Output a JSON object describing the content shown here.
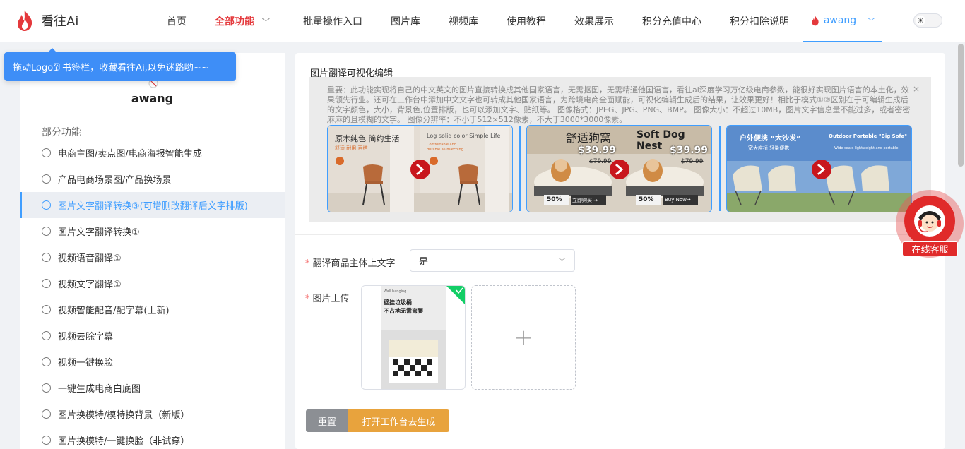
{
  "header": {
    "logo_text": "看往Ai",
    "nav": [
      {
        "label": "首页"
      },
      {
        "label": "全部功能",
        "active": true
      },
      {
        "label": "批量操作入口"
      },
      {
        "label": "图片库"
      },
      {
        "label": "视频库"
      },
      {
        "label": "使用教程"
      },
      {
        "label": "效果展示"
      },
      {
        "label": "积分充值中心"
      },
      {
        "label": "积分扣除说明"
      }
    ],
    "user": "awang",
    "theme_toggle_icon": "sun-icon"
  },
  "tooltip": {
    "text": "拖动Logo到书签栏，收藏看往Ai,以免迷路哟~~"
  },
  "sidebar": {
    "user_name": "awang",
    "section_title": "部分功能",
    "items": [
      {
        "label": "电商主图/卖点图/电商海报智能生成"
      },
      {
        "label": "产品电商场景图/产品换场景"
      },
      {
        "label": "图片文字翻译转换③(可增删改翻译后文字排版)",
        "active": true
      },
      {
        "label": "图片文字翻译转换①"
      },
      {
        "label": "视频语音翻译①"
      },
      {
        "label": "视频文字翻译①"
      },
      {
        "label": "视频智能配音/配字幕(上新)"
      },
      {
        "label": "视频去除字幕"
      },
      {
        "label": "视频一键换脸"
      },
      {
        "label": "一键生成电商白底图"
      },
      {
        "label": "图片换模特/模特换背景（新版）"
      },
      {
        "label": "图片换模特/一键换脸（非试穿）"
      }
    ]
  },
  "main": {
    "title": "图片翻译可视化编辑",
    "notice": "重要：此功能实现将自己的中文英文的图片直接转换成其他国家语言，无需抠图，无需精通他国语言，看往ai深度学习万亿级电商参数，能很好实现图片语言的本土化，效果领先行业。还可在工作台中添加中文文字也可转成其他国家语言，为跨境电商全面赋能，可视化编辑生成后的结果，让效果更好！相比于模式①②区别在于可编辑生成后的文字颜色，大小，背景色,位置排版，也可以添加文字、贴纸等。 图像格式：JPEG、JPG、PNG、BMP。 图像大小：不超过10MB，图片文字信息量不能过多，或者密密麻麻的且模糊的文字。 图像分辨率：不小于512×512像素，不大于3000*3000像素。",
    "notice_close": "×",
    "demos": [
      {
        "left_title": "原木纯色 简约生活",
        "left_sub": "舒适 耐用 百搭",
        "right_title": "Log solid color  Simple Life",
        "right_sub1": "Comfortable and",
        "right_sub2": "durable all-matching"
      },
      {
        "left_title": "舒适狗窝",
        "left_price": "$39.99",
        "left_old": "$79.99",
        "left_badge": "50%",
        "left_btn": "立即购买 →",
        "right_title": "Soft Dog Nest",
        "right_price": "$39.99",
        "right_old": "$79.99",
        "right_badge": "50%",
        "right_btn": "Buy Now→"
      },
      {
        "left_title": "户外便携 “大沙发”",
        "left_sub": "宽大座椅  轻量便携",
        "right_title": "Outdoor Portable \"Big Sofa\"",
        "right_sub": "Wide seats lightweight and portable"
      }
    ],
    "form": {
      "field1_label": "翻译商品主体上文字",
      "field1_value": "是",
      "field2_label": "图片上传",
      "thumb_top": "壁挂垃圾桶",
      "thumb_top2": "不占地无需弯腰",
      "thumb_small": "Wall hanging"
    },
    "buttons": {
      "reset": "重置",
      "open": "打开工作台去生成"
    }
  },
  "service": {
    "label": "在线客服"
  },
  "colors": {
    "accent": "#409eff",
    "brand_red": "#e4393c",
    "orange": "#e8a33d"
  }
}
